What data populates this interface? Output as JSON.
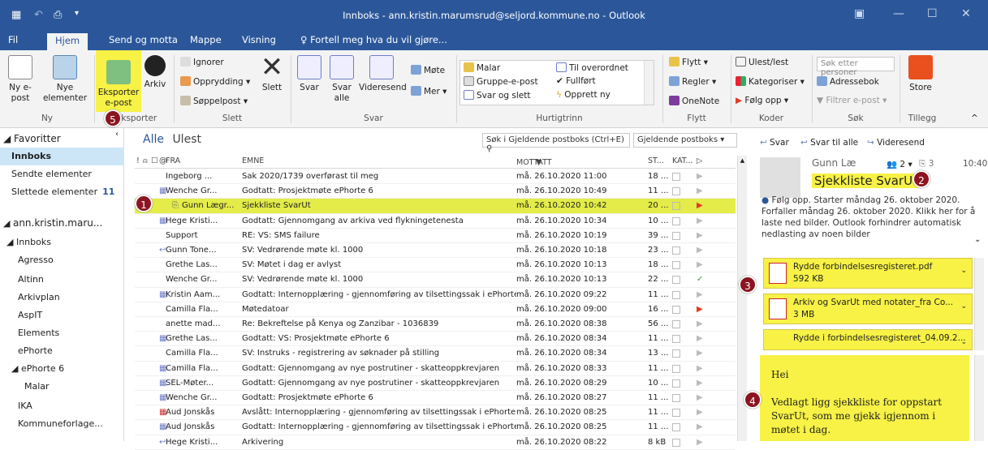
{
  "window": {
    "title": "Innboks - ann.kristin.marumsrud@seljord.kommune.no - Outlook"
  },
  "tabs": [
    "Fil",
    "Hjem",
    "Send og motta",
    "Mappe",
    "Visning",
    "Fortell meg hva du vil gjøre..."
  ],
  "ribbon": {
    "ny_epost": "Ny e-post",
    "nye_elementer": "Nye elementer",
    "eksporter": "Eksporter e-post",
    "arkiv": "Arkiv",
    "ignorer": "Ignorer",
    "opprydding": "Opprydding",
    "soppelpost": "Søppelpost",
    "slett": "Slett",
    "svar": "Svar",
    "svar_alle": "Svar alle",
    "videresend": "Videresend",
    "mote": "Møte",
    "mer": "Mer",
    "qs_malar": "Malar",
    "qs_gruppe": "Gruppe-e-post",
    "qs_svar_slett": "Svar og slett",
    "qs_overordnet": "Til overordnet",
    "qs_fullfort": "Fullført",
    "qs_opprett": "Opprett ny",
    "flytt": "Flytt",
    "regler": "Regler",
    "onenote": "OneNote",
    "ulest": "Ulest/lest",
    "kategoriser": "Kategoriser",
    "folg_opp": "Følg opp",
    "sok_personer": "Søk etter personer",
    "adressebok": "Adressebok",
    "filtrer": "Filtrer e-post",
    "store": "Store",
    "groups": {
      "ny": "Ny",
      "eksporter": "Eksporter",
      "slett": "Slett",
      "svar": "Svar",
      "hurtigtrinn": "Hurtigtrinn",
      "flytt": "Flytt",
      "koder": "Koder",
      "sok": "Søk",
      "tillegg": "Tillegg"
    }
  },
  "folders": {
    "favoritter": "Favoritter",
    "items": [
      {
        "label": "Innboks",
        "count": "",
        "bold": true,
        "indent": 14
      },
      {
        "label": "Sendte elementer",
        "count": "",
        "indent": 14
      },
      {
        "label": "Slettede elementer",
        "count": "11",
        "indent": 14
      },
      {
        "label": "ann.kristin.maru...",
        "count": "",
        "indent": 4
      },
      {
        "label": "Innboks",
        "count": "",
        "indent": 8
      },
      {
        "label": "Agresso",
        "count": "",
        "indent": 22
      },
      {
        "label": "Altinn",
        "count": "",
        "indent": 22
      },
      {
        "label": "Arkivplan",
        "count": "",
        "indent": 22
      },
      {
        "label": "AspIT",
        "count": "",
        "indent": 22
      },
      {
        "label": "Elements",
        "count": "",
        "indent": 22
      },
      {
        "label": "ePhorte",
        "count": "",
        "indent": 22
      },
      {
        "label": "ePhorte 6",
        "count": "",
        "indent": 14
      },
      {
        "label": "Malar",
        "count": "",
        "indent": 30
      },
      {
        "label": "IKA",
        "count": "",
        "indent": 22
      },
      {
        "label": "Kommuneforlage...",
        "count": "",
        "indent": 22
      }
    ]
  },
  "list": {
    "filter_all": "Alle",
    "filter_unread": "Ulest",
    "search_placeholder": "Søk i Gjeldende postboks (Ctrl+E)",
    "scope": "Gjeldende postboks",
    "headers": {
      "fra": "FRA",
      "emne": "EMNE",
      "mottatt": "MOTTATT",
      "st": "ST...",
      "kat": "KAT..."
    },
    "rows": [
      {
        "from": "Ingeborg ...",
        "subject": "Sak 2020/1739 overførast til meg",
        "date": "må. 26.10.2020 11:00",
        "size": "18 ...",
        "icon": "",
        "flag": "grey"
      },
      {
        "from": "Wenche Gr...",
        "subject": "Godtatt: Prosjektmøte ePhorte 6",
        "date": "må. 26.10.2020 10:49",
        "size": "11 ...",
        "icon": "meeting",
        "flag": "grey"
      },
      {
        "from": "Gunn Lægr...",
        "subject": "Sjekkliste SvarUt",
        "date": "må. 26.10.2020 10:42",
        "size": "20 ...",
        "icon": "clip",
        "flag": "red",
        "selected": true
      },
      {
        "from": "Hege Kristi...",
        "subject": "Godtatt: Gjennomgang av arkiva ved flykningetenesta",
        "date": "må. 26.10.2020 10:34",
        "size": "10 ...",
        "icon": "meeting",
        "flag": "grey"
      },
      {
        "from": "Support",
        "subject": "RE: VS: SMS failure",
        "date": "må. 26.10.2020 10:19",
        "size": "39 ...",
        "icon": "",
        "flag": "grey"
      },
      {
        "from": "Gunn Tone...",
        "subject": "SV: Vedrørende møte kl. 1000",
        "date": "må. 26.10.2020 10:18",
        "size": "23 ...",
        "icon": "reply",
        "flag": "grey"
      },
      {
        "from": "Grethe Las...",
        "subject": "SV: Møtet i dag er avlyst",
        "date": "må. 26.10.2020 10:13",
        "size": "18 ...",
        "icon": "",
        "flag": "grey"
      },
      {
        "from": "Wenche Gr...",
        "subject": "SV: Vedrørende møte kl. 1000",
        "date": "må. 26.10.2020 10:13",
        "size": "22 ...",
        "icon": "",
        "flag": "done"
      },
      {
        "from": "Kristin Aam...",
        "subject": "Godtatt: Internopplæring - gjennomføring av tilsettingssak i ePhorte",
        "date": "må. 26.10.2020 09:22",
        "size": "11 ...",
        "icon": "meeting",
        "flag": "grey"
      },
      {
        "from": "Camilla Fla...",
        "subject": "Møtedatoar",
        "date": "må. 26.10.2020 09:00",
        "size": "16 ...",
        "icon": "",
        "flag": "red"
      },
      {
        "from": "anette mad...",
        "subject": "Re: Bekreftelse på Kenya og Zanzibar - 1036839",
        "date": "må. 26.10.2020 08:38",
        "size": "56 ...",
        "icon": "",
        "flag": "grey"
      },
      {
        "from": "Grethe Las...",
        "subject": "Godtatt: VS: Prosjektmøte ePhorte 6",
        "date": "må. 26.10.2020 08:34",
        "size": "11 ...",
        "icon": "meeting",
        "flag": "grey"
      },
      {
        "from": "Camilla Fla...",
        "subject": "SV: Instruks - registrering av søknader på stilling",
        "date": "må. 26.10.2020 08:34",
        "size": "13 ...",
        "icon": "",
        "flag": "grey"
      },
      {
        "from": "Camilla Fla...",
        "subject": "Godtatt: Gjennomgang av nye postrutiner - skatteoppkrevjaren",
        "date": "må. 26.10.2020 08:33",
        "size": "11 ...",
        "icon": "meeting",
        "flag": "grey"
      },
      {
        "from": "SEL-Møter...",
        "subject": "Godtatt: Gjennomgang av nye postrutiner - skatteoppkrevjaren",
        "date": "må. 26.10.2020 08:29",
        "size": "10 ...",
        "icon": "meeting",
        "flag": "grey"
      },
      {
        "from": "Wenche Gr...",
        "subject": "Godtatt: Prosjektmøte ePhorte 6",
        "date": "må. 26.10.2020 08:27",
        "size": "11 ...",
        "icon": "meeting",
        "flag": "grey"
      },
      {
        "from": "Aud Jonskås",
        "subject": "Avslått: Internopplæring - gjennomføring av tilsettingssak i ePhorte",
        "date": "må. 26.10.2020 08:25",
        "size": "11 ...",
        "icon": "decline",
        "flag": "grey"
      },
      {
        "from": "Aud Jonskås",
        "subject": "Godtatt: Internopplæring - gjennomføring av tilsettingssak i ePhorte",
        "date": "må. 26.10.2020 08:25",
        "size": "11 ...",
        "icon": "meeting",
        "flag": "grey"
      },
      {
        "from": "Hege Kristi...",
        "subject": "Arkivering",
        "date": "må. 26.10.2020 08:22",
        "size": "8 kB",
        "icon": "reply",
        "flag": "grey"
      }
    ]
  },
  "reading": {
    "svar": "Svar",
    "svar_alle": "Svar til alle",
    "videresend": "Videresend",
    "sender": "Gunn Læ",
    "people_count": "2",
    "attach_count": "3",
    "time": "10:40",
    "subject": "Sjekkliste SvarUt",
    "info": "Følg opp. Starter måndag 26. oktober 2020. Forfaller måndag 26. oktober 2020. Klikk her for å laste ned bilder. Outlook forhindrer automatisk nedlasting av noen bilder",
    "attachments": [
      {
        "name": "Rydde forbindelsesregisteret.pdf",
        "size": "592 KB"
      },
      {
        "name": "Arkiv og SvarUt med notater_fra Co...",
        "size": "3 MB"
      },
      {
        "name": "Rydde i forbindelsesregisteret_04.09.2...",
        "size": ""
      }
    ],
    "body_line1": "Hei",
    "body_line2": "Vedlagt ligg sjekkliste for oppstart SvarUt, som me gjekk igjennom i møtet i dag."
  },
  "callouts": [
    "1",
    "2",
    "3",
    "4",
    "5"
  ],
  "colors": {
    "brand": "#2b579a",
    "highlight": "#f7f245",
    "badge": "#8c1420"
  }
}
